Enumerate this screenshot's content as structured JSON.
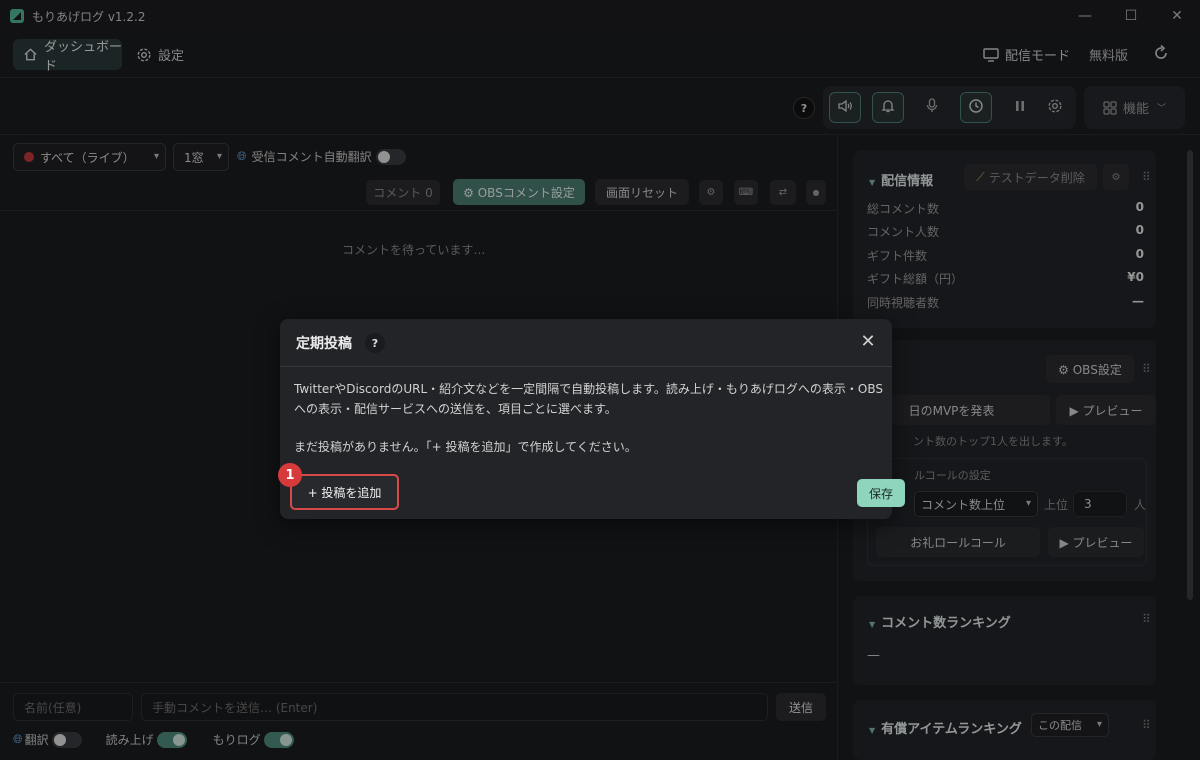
{
  "window": {
    "title": "もりあげログ v1.2.2",
    "min": "—",
    "max": "☐",
    "close": "✕"
  },
  "nav": {
    "dashboard": "ダッシュボード",
    "settings": "設定",
    "broadcast_mode": "配信モード",
    "plan": "無料版"
  },
  "toolbar": {
    "help": "?",
    "functions": "機能"
  },
  "comments": {
    "filter": "すべて（ライブ）",
    "window": "1窓",
    "auto_translate": "受信コメント自動翻訳",
    "count_label": "コメント 0",
    "obs_settings": "⚙ OBSコメント設定",
    "screen_reset": "画面リセット",
    "waiting": "コメントを待っています…"
  },
  "composer": {
    "name_placeholder": "名前(任意)",
    "comment_placeholder": "手動コメントを送信… (Enter)",
    "send": "送信",
    "translate": "翻訳",
    "read_aloud": "読み上げ",
    "morilog": "もりログ"
  },
  "stream_info": {
    "title": "配信情報",
    "delete_test": "テストデータ削除",
    "stats": [
      {
        "label": "総コメント数",
        "value": "0"
      },
      {
        "label": "コメント人数",
        "value": "0"
      },
      {
        "label": "ギフト件数",
        "value": "0"
      },
      {
        "label": "ギフト総額（円）",
        "value": "¥0"
      },
      {
        "label": "同時視聴者数",
        "value": "—"
      }
    ]
  },
  "mvp": {
    "obs_settings": "⚙ OBS設定",
    "announce": "日のMVPを発表",
    "preview": "▶ プレビュー",
    "note": "ント数のトップ1人を出します。",
    "rollcall_title": "ルコールの設定",
    "sort": "コメント数上位",
    "top_label": "上位",
    "top_value": "3",
    "unit": "人",
    "rollcall": "お礼ロールコール",
    "preview2": "▶ プレビュー"
  },
  "ranking": {
    "title": "コメント数ランキング",
    "empty": "—"
  },
  "paid": {
    "title": "有償アイテムランキング",
    "scope": "この配信"
  },
  "modal": {
    "title": "定期投稿",
    "help": "?",
    "close": "✕",
    "description": "TwitterやDiscordのURL・紹介文などを一定間隔で自動投稿します。読み上げ・もりあげログへの表示・OBSへの表示・配信サービスへの送信を、項目ごとに選べます。",
    "empty": "まだ投稿がありません。「+ 投稿を追加」で作成してください。",
    "add": "+ 投稿を追加",
    "save": "保存",
    "badge": "1"
  }
}
